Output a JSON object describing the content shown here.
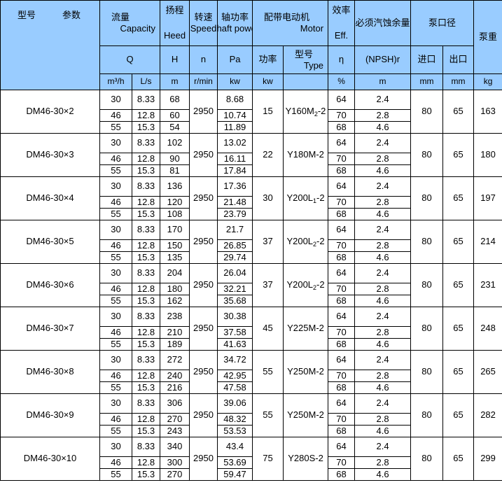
{
  "theme": {
    "header_bg": "#99ccff",
    "border": "#000000",
    "text": "#000000"
  },
  "header": {
    "corner": {
      "model_label": "型号",
      "param_label": "参数"
    },
    "groups": [
      {
        "cn": "流量",
        "en": "Capacity",
        "symbol": "Q",
        "units": [
          "m³/h",
          "L/s"
        ]
      },
      {
        "cn": "扬程",
        "en": "Heed",
        "symbol": "H",
        "units": [
          "m"
        ]
      },
      {
        "cn": "转速",
        "en": "Speed",
        "symbol": "n",
        "units": [
          "r/min"
        ]
      },
      {
        "cn": "轴功率",
        "en": "Shaft power",
        "symbol": "Pa",
        "units": [
          "kw"
        ]
      },
      {
        "cn": "配带电动机",
        "en": "Motor",
        "sub_cn": [
          "功率",
          "型号"
        ],
        "sub_en": [
          "",
          "Type"
        ],
        "units": [
          "kw",
          ""
        ]
      },
      {
        "cn": "效率",
        "en": "Eff.",
        "symbol": "η",
        "units": [
          "%"
        ]
      },
      {
        "cn": "必须汽蚀余量",
        "en": "",
        "symbol": "(NPSH)r",
        "units": [
          "m"
        ]
      },
      {
        "cn": "泵口径",
        "en": "",
        "sub_cn": [
          "进口",
          "出口"
        ],
        "units": [
          "mm",
          "mm"
        ]
      },
      {
        "cn": "泵重",
        "en": "",
        "units": [
          "kg"
        ]
      }
    ],
    "unit_row": [
      "m³/h",
      "L/s",
      "m",
      "r/min",
      "kw",
      "kw",
      "",
      "%",
      "m",
      "mm",
      "mm",
      "kg"
    ]
  },
  "table_data": {
    "columns": [
      "型号",
      "m³/h",
      "L/s",
      "m",
      "r/min",
      "kw",
      "kw",
      "Type",
      "%",
      "m",
      "mm(进口)",
      "mm(出口)",
      "kg"
    ],
    "rows": [
      {
        "model": "DM46-30×2",
        "capacity_m3h": [
          30,
          46,
          55
        ],
        "capacity_ls": [
          "8.33",
          "12.8",
          "15.3"
        ],
        "head_m": [
          68,
          60,
          54
        ],
        "speed": 2950,
        "shaft_power": [
          "8.68",
          "10.74",
          "11.89"
        ],
        "motor_power": 15,
        "motor_type": "Y160M₂-2",
        "motor_type_base": "Y160M",
        "motor_type_sub": "2",
        "motor_type_tail": "-2",
        "eff": [
          64,
          70,
          68
        ],
        "npshr": [
          "2.4",
          "2.8",
          "4.6"
        ],
        "inlet": 80,
        "outlet": 65,
        "weight": 163
      },
      {
        "model": "DM46-30×3",
        "capacity_m3h": [
          30,
          46,
          55
        ],
        "capacity_ls": [
          "8.33",
          "12.8",
          "15.3"
        ],
        "head_m": [
          102,
          90,
          81
        ],
        "speed": 2950,
        "shaft_power": [
          "13.02",
          "16.11",
          "17.84"
        ],
        "motor_power": 22,
        "motor_type": "Y180M-2",
        "motor_type_base": "Y180M",
        "motor_type_sub": "",
        "motor_type_tail": "-2",
        "eff": [
          64,
          70,
          68
        ],
        "npshr": [
          "2.4",
          "2.8",
          "4.6"
        ],
        "inlet": 80,
        "outlet": 65,
        "weight": 180
      },
      {
        "model": "DM46-30×4",
        "capacity_m3h": [
          30,
          46,
          55
        ],
        "capacity_ls": [
          "8.33",
          "12.8",
          "15.3"
        ],
        "head_m": [
          136,
          120,
          108
        ],
        "speed": 2950,
        "shaft_power": [
          "17.36",
          "21.48",
          "23.79"
        ],
        "motor_power": 30,
        "motor_type": "Y200L₁-2",
        "motor_type_base": "Y200L",
        "motor_type_sub": "1",
        "motor_type_tail": "-2",
        "eff": [
          64,
          70,
          68
        ],
        "npshr": [
          "2.4",
          "2.8",
          "4.6"
        ],
        "inlet": 80,
        "outlet": 65,
        "weight": 197
      },
      {
        "model": "DM46-30×5",
        "capacity_m3h": [
          30,
          46,
          55
        ],
        "capacity_ls": [
          "8.33",
          "12.8",
          "15.3"
        ],
        "head_m": [
          170,
          150,
          135
        ],
        "speed": 2950,
        "shaft_power": [
          "21.7",
          "26.85",
          "29.74"
        ],
        "motor_power": 37,
        "motor_type": "Y200L₂-2",
        "motor_type_base": "Y200L",
        "motor_type_sub": "2",
        "motor_type_tail": "-2",
        "eff": [
          64,
          70,
          68
        ],
        "npshr": [
          "2.4",
          "2.8",
          "4.6"
        ],
        "inlet": 80,
        "outlet": 65,
        "weight": 214
      },
      {
        "model": "DM46-30×6",
        "capacity_m3h": [
          30,
          46,
          55
        ],
        "capacity_ls": [
          "8.33",
          "12.8",
          "15.3"
        ],
        "head_m": [
          204,
          180,
          162
        ],
        "speed": 2950,
        "shaft_power": [
          "26.04",
          "32.21",
          "35.68"
        ],
        "motor_power": 37,
        "motor_type": "Y200L₂-2",
        "motor_type_base": "Y200L",
        "motor_type_sub": "2",
        "motor_type_tail": "-2",
        "eff": [
          64,
          70,
          68
        ],
        "npshr": [
          "2.4",
          "2.8",
          "4.6"
        ],
        "inlet": 80,
        "outlet": 65,
        "weight": 231
      },
      {
        "model": "DM46-30×7",
        "capacity_m3h": [
          30,
          46,
          55
        ],
        "capacity_ls": [
          "8.33",
          "12.8",
          "15.3"
        ],
        "head_m": [
          238,
          210,
          189
        ],
        "speed": 2950,
        "shaft_power": [
          "30.38",
          "37.58",
          "41.63"
        ],
        "motor_power": 45,
        "motor_type": "Y225M-2",
        "motor_type_base": "Y225M",
        "motor_type_sub": "",
        "motor_type_tail": "-2",
        "eff": [
          64,
          70,
          68
        ],
        "npshr": [
          "2.4",
          "2.8",
          "4.6"
        ],
        "inlet": 80,
        "outlet": 65,
        "weight": 248
      },
      {
        "model": "DM46-30×8",
        "capacity_m3h": [
          30,
          46,
          55
        ],
        "capacity_ls": [
          "8.33",
          "12.8",
          "15.3"
        ],
        "head_m": [
          272,
          240,
          216
        ],
        "speed": 2950,
        "shaft_power": [
          "34.72",
          "42.95",
          "47.58"
        ],
        "motor_power": 55,
        "motor_type": "Y250M-2",
        "motor_type_base": "Y250M",
        "motor_type_sub": "",
        "motor_type_tail": "-2",
        "eff": [
          64,
          70,
          68
        ],
        "npshr": [
          "2.4",
          "2.8",
          "4.6"
        ],
        "inlet": 80,
        "outlet": 65,
        "weight": 265
      },
      {
        "model": "DM46-30×9",
        "capacity_m3h": [
          30,
          46,
          55
        ],
        "capacity_ls": [
          "8.33",
          "12.8",
          "15.3"
        ],
        "head_m": [
          306,
          270,
          243
        ],
        "speed": 2950,
        "shaft_power": [
          "39.06",
          "48.32",
          "53.53"
        ],
        "motor_power": 55,
        "motor_type": "Y250M-2",
        "motor_type_base": "Y250M",
        "motor_type_sub": "",
        "motor_type_tail": "-2",
        "eff": [
          64,
          70,
          68
        ],
        "npshr": [
          "2.4",
          "2.8",
          "4.6"
        ],
        "inlet": 80,
        "outlet": 65,
        "weight": 282
      },
      {
        "model": "DM46-30×10",
        "capacity_m3h": [
          30,
          46,
          55
        ],
        "capacity_ls": [
          "8.33",
          "12.8",
          "15.3"
        ],
        "head_m": [
          340,
          300,
          270
        ],
        "speed": 2950,
        "shaft_power": [
          "43.4",
          "53.69",
          "59.47"
        ],
        "motor_power": 75,
        "motor_type": "Y280S-2",
        "motor_type_base": "Y280S",
        "motor_type_sub": "",
        "motor_type_tail": "-2",
        "eff": [
          64,
          70,
          68
        ],
        "npshr": [
          "2.4",
          "2.8",
          "4.6"
        ],
        "inlet": 80,
        "outlet": 65,
        "weight": 299
      }
    ]
  }
}
